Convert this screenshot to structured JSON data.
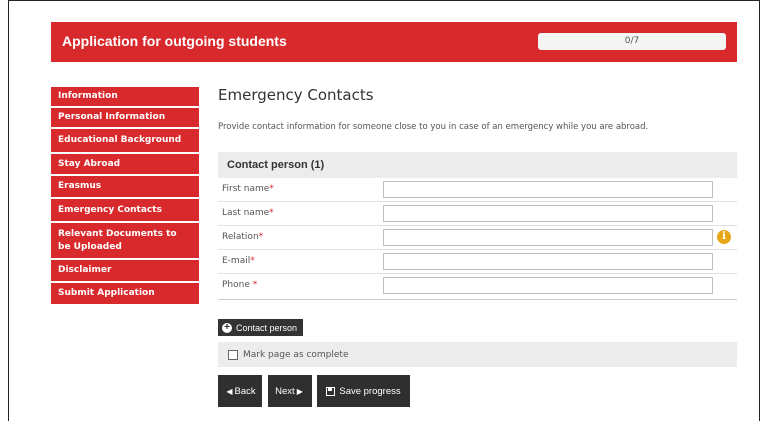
{
  "header": {
    "title": "Application for outgoing students",
    "progress_text": "0/7",
    "progress_fraction": 0
  },
  "sidebar": {
    "items": [
      {
        "label": "Information"
      },
      {
        "label": "Personal Information"
      },
      {
        "label": "Educational Background"
      },
      {
        "label": "Stay Abroad"
      },
      {
        "label": "Erasmus"
      },
      {
        "label": "Emergency Contacts"
      },
      {
        "label": "Relevant Documents to be Uploaded"
      },
      {
        "label": "Disclaimer"
      },
      {
        "label": "Submit Application"
      }
    ]
  },
  "main": {
    "title": "Emergency Contacts",
    "description": "Provide contact information for someone close to you in case of an emergency while you are abroad.",
    "section_title": "Contact person (1)",
    "required_marker": "*",
    "fields": [
      {
        "label": "First name",
        "value": ""
      },
      {
        "label": "Last name",
        "value": ""
      },
      {
        "label": "Relation",
        "value": ""
      },
      {
        "label": "E-mail",
        "value": ""
      },
      {
        "label": "Phone ",
        "value": ""
      }
    ],
    "info_icon_glyph": "i",
    "add_contact_label": "Contact person",
    "complete_label": "Mark page as complete",
    "complete_checked": false
  },
  "buttons": {
    "back": "Back",
    "next": "Next",
    "save": "Save progress"
  },
  "colors": {
    "brand_red": "#d8292d",
    "button_dark": "#2f2f2f",
    "info_yellow": "#e6a817"
  },
  "icons": {
    "add": "plus-circle-icon",
    "back": "chevron-left-icon",
    "next": "chevron-right-icon",
    "save": "save-icon",
    "info": "info-icon"
  }
}
